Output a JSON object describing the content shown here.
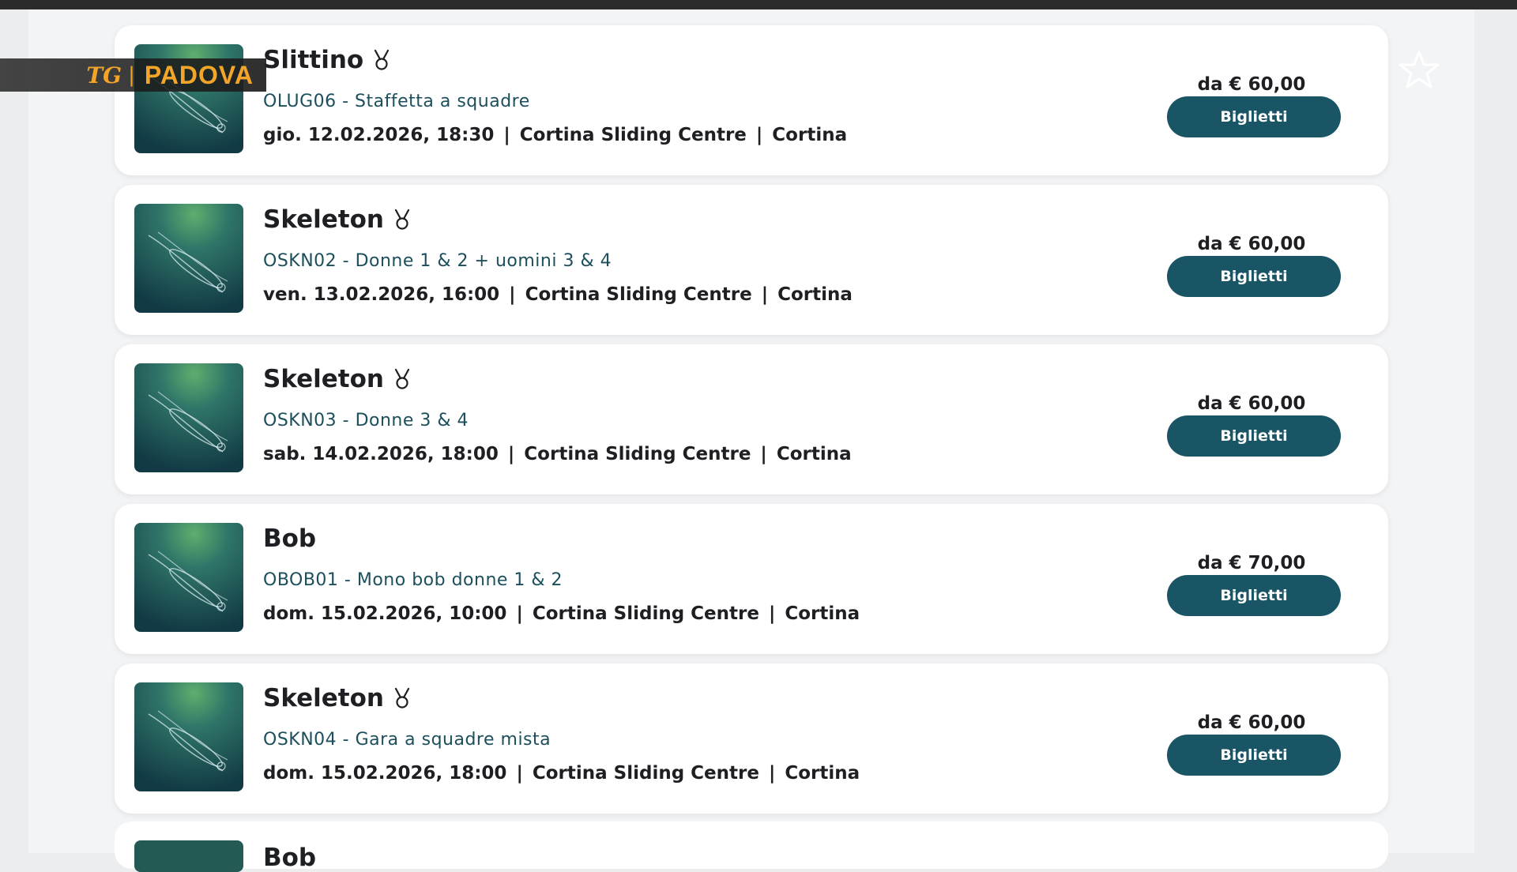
{
  "overlay": {
    "channel_logo": "TG",
    "city": "PADOVA"
  },
  "events": [
    {
      "title": "Slittino",
      "medal": true,
      "code": "OLUG06 - Staffetta a squadre",
      "datetime": "gio. 12.02.2026, 18:30",
      "venue": "Cortina Sliding Centre",
      "city": "Cortina",
      "price": "da € 60,00",
      "button": "Biglietti"
    },
    {
      "title": "Skeleton",
      "medal": true,
      "code": "OSKN02 - Donne 1 & 2 + uomini 3 & 4",
      "datetime": "ven. 13.02.2026, 16:00",
      "venue": "Cortina Sliding Centre",
      "city": "Cortina",
      "price": "da € 60,00",
      "button": "Biglietti"
    },
    {
      "title": "Skeleton",
      "medal": true,
      "code": "OSKN03 - Donne 3 & 4",
      "datetime": "sab. 14.02.2026, 18:00",
      "venue": "Cortina Sliding Centre",
      "city": "Cortina",
      "price": "da € 60,00",
      "button": "Biglietti"
    },
    {
      "title": "Bob",
      "medal": false,
      "code": "OBOB01 - Mono bob donne 1 & 2",
      "datetime": "dom. 15.02.2026, 10:00",
      "venue": "Cortina Sliding Centre",
      "city": "Cortina",
      "price": "da € 70,00",
      "button": "Biglietti"
    },
    {
      "title": "Skeleton",
      "medal": true,
      "code": "OSKN04 - Gara a squadre mista",
      "datetime": "dom. 15.02.2026, 18:00",
      "venue": "Cortina Sliding Centre",
      "city": "Cortina",
      "price": "da € 60,00",
      "button": "Biglietti"
    }
  ],
  "partial_event": {
    "title": "Bob"
  },
  "colors": {
    "button": "#1a5566",
    "code_text": "#1c4f5c",
    "overlay_text": "#f3a52a"
  }
}
